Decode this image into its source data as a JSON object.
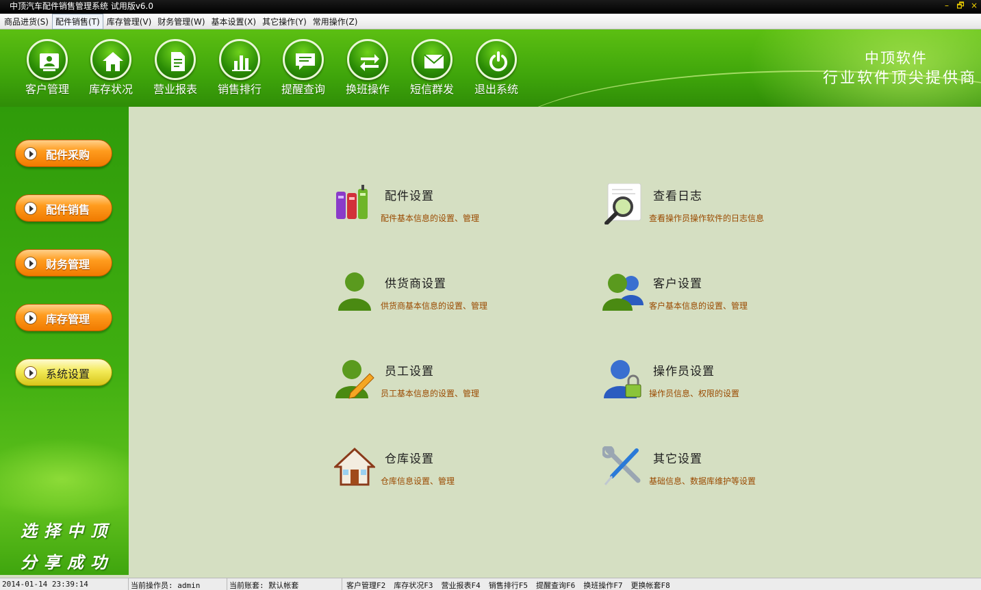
{
  "window": {
    "title": "中顶汽车配件销售管理系统 试用版v6.0",
    "controls": [
      "–",
      "🗗",
      "×"
    ]
  },
  "menubar": {
    "items": [
      {
        "label": "商品进货(S)"
      },
      {
        "label": "配件销售(T)"
      },
      {
        "label": "库存管理(V)"
      },
      {
        "label": "财务管理(W)"
      },
      {
        "label": "基本设置(X)"
      },
      {
        "label": "其它操作(Y)"
      },
      {
        "label": "常用操作(Z)"
      }
    ]
  },
  "toolbar": {
    "buttons": [
      {
        "label": "客户管理",
        "icon": "customer-card-icon"
      },
      {
        "label": "库存状况",
        "icon": "house-icon"
      },
      {
        "label": "营业报表",
        "icon": "report-document-icon"
      },
      {
        "label": "销售排行",
        "icon": "bar-chart-icon"
      },
      {
        "label": "提醒查询",
        "icon": "message-bubble-icon"
      },
      {
        "label": "换班操作",
        "icon": "swap-arrows-icon"
      },
      {
        "label": "短信群发",
        "icon": "envelope-icon"
      },
      {
        "label": "退出系统",
        "icon": "power-icon"
      }
    ],
    "brand_line1": "中顶软件",
    "brand_line2": "行业软件顶尖提供商"
  },
  "sidebar": {
    "buttons": [
      {
        "label": "配件采购",
        "style": "orange"
      },
      {
        "label": "配件销售",
        "style": "orange"
      },
      {
        "label": "财务管理",
        "style": "orange"
      },
      {
        "label": "库存管理",
        "style": "orange"
      },
      {
        "label": "系统设置",
        "style": "yellow"
      }
    ],
    "slogan_line1": "选择中顶",
    "slogan_line2": "分享成功"
  },
  "main": {
    "entries": [
      {
        "title": "配件设置",
        "desc": "配件基本信息的设置、管理",
        "icon": "books-icon"
      },
      {
        "title": "查看日志",
        "desc": "查看操作员操作软件的日志信息",
        "icon": "magnifier-document-icon"
      },
      {
        "title": "供货商设置",
        "desc": "供货商基本信息的设置、管理",
        "icon": "supplier-user-icon"
      },
      {
        "title": "客户设置",
        "desc": "客户基本信息的设置、管理",
        "icon": "customers-users-icon"
      },
      {
        "title": "员工设置",
        "desc": "员工基本信息的设置、管理",
        "icon": "employee-pencil-icon"
      },
      {
        "title": "操作员设置",
        "desc": "操作员信息、权限的设置",
        "icon": "operator-lock-icon"
      },
      {
        "title": "仓库设置",
        "desc": "仓库信息设置、管理",
        "icon": "warehouse-house-icon"
      },
      {
        "title": "其它设置",
        "desc": "基础信息、数据库维护等设置",
        "icon": "tools-wrench-screwdriver-icon"
      }
    ]
  },
  "statusbar": {
    "datetime": "2014-01-14 23:39:14",
    "operator": "当前操作员: admin",
    "account": "当前账套: 默认帐套",
    "shortcuts": [
      "客户管理F2",
      "库存状况F3",
      "营业报表F4",
      "销售排行F5",
      "提醒查询F6",
      "换班操作F7",
      "更换帐套F8"
    ]
  },
  "colors": {
    "toolbar_green": "#3fa50b",
    "main_bg": "#d5dfc2",
    "desc_text": "#9a4a00",
    "side_button_orange": "#ff9c1e",
    "side_button_yellow": "#f3ea58"
  }
}
